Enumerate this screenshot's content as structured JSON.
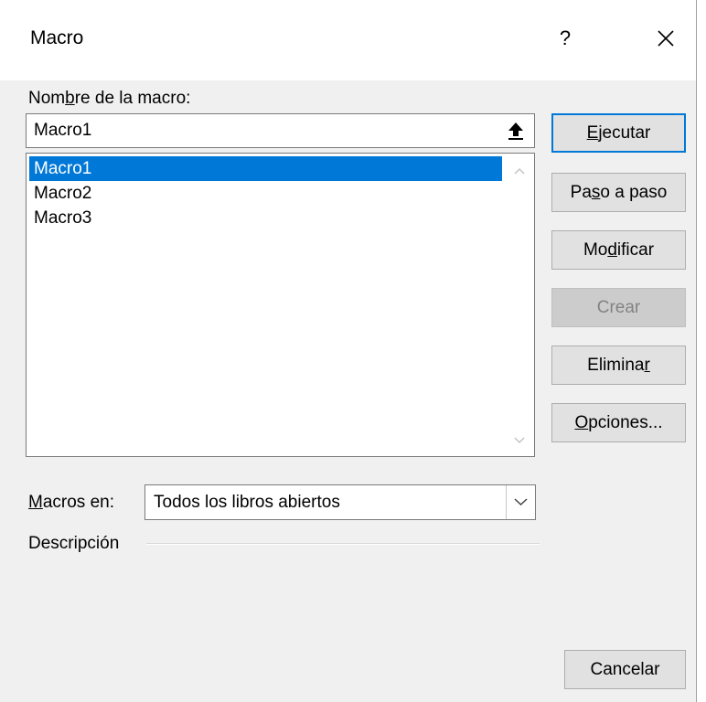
{
  "window": {
    "title": "Macro",
    "help_label": "?",
    "close_icon": "close-icon"
  },
  "macro_name": {
    "label_pre": "Nom",
    "label_key": "b",
    "label_post": "re de la macro:",
    "value": "Macro1",
    "upload_icon": "upload-arrow-icon"
  },
  "macro_list": {
    "items": [
      "Macro1",
      "Macro2",
      "Macro3"
    ],
    "selected_index": 0,
    "scroll_up_icon": "chevron-up-icon",
    "scroll_down_icon": "chevron-down-icon"
  },
  "buttons": {
    "run": {
      "pre": "",
      "key": "E",
      "post": "jecutar"
    },
    "step": {
      "pre": "Pa",
      "key": "s",
      "post": "o a paso"
    },
    "edit": {
      "pre": "Mo",
      "key": "d",
      "post": "ificar"
    },
    "create": {
      "label": "Crear"
    },
    "delete": {
      "pre": "Elimina",
      "key": "r",
      "post": ""
    },
    "options": {
      "pre": "",
      "key": "O",
      "post": "pciones..."
    },
    "cancel": {
      "label": "Cancelar"
    }
  },
  "macros_in": {
    "label_key": "M",
    "label_post": "acros en:",
    "value": "Todos los libros abiertos",
    "dropdown_icon": "chevron-down-icon"
  },
  "description": {
    "label": "Descripción"
  },
  "colors": {
    "selection": "#0078d7",
    "dialog_bg": "#f0f0f0",
    "default_border": "#0078d7"
  }
}
